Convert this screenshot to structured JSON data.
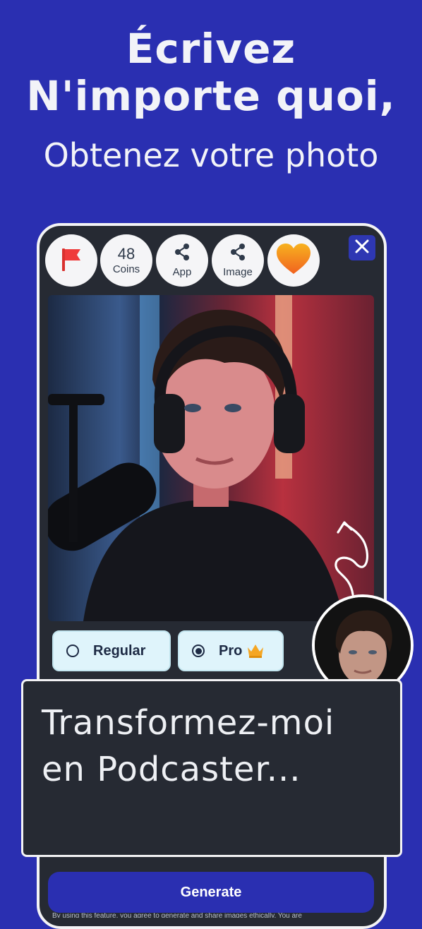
{
  "hero": {
    "line1": "Écrivez",
    "line2": "N'importe quoi,",
    "line3": "Obtenez votre photo"
  },
  "toolbar": {
    "coins_count": "48",
    "coins_label": "Coins",
    "share_app_label": "App",
    "share_image_label": "Image"
  },
  "icons": {
    "flag": "flag-icon",
    "share": "share-icon",
    "heart": "heart-icon",
    "close": "close-icon",
    "crown": "crown-icon"
  },
  "mode": {
    "regular_label": "Regular",
    "pro_label": "Pro",
    "selected": "Pro"
  },
  "prompt": {
    "text": "Transformez-moi en Podcaster..."
  },
  "generate_label": "Generate",
  "disclaimer": "By using this feature, you agree to generate and share images ethically. You are",
  "colors": {
    "background": "#2a2fb1",
    "card": "#262a33",
    "button_light": "#dff4fb",
    "flag_red": "#ef3b3b",
    "heart_orange": "#f5a01a"
  }
}
